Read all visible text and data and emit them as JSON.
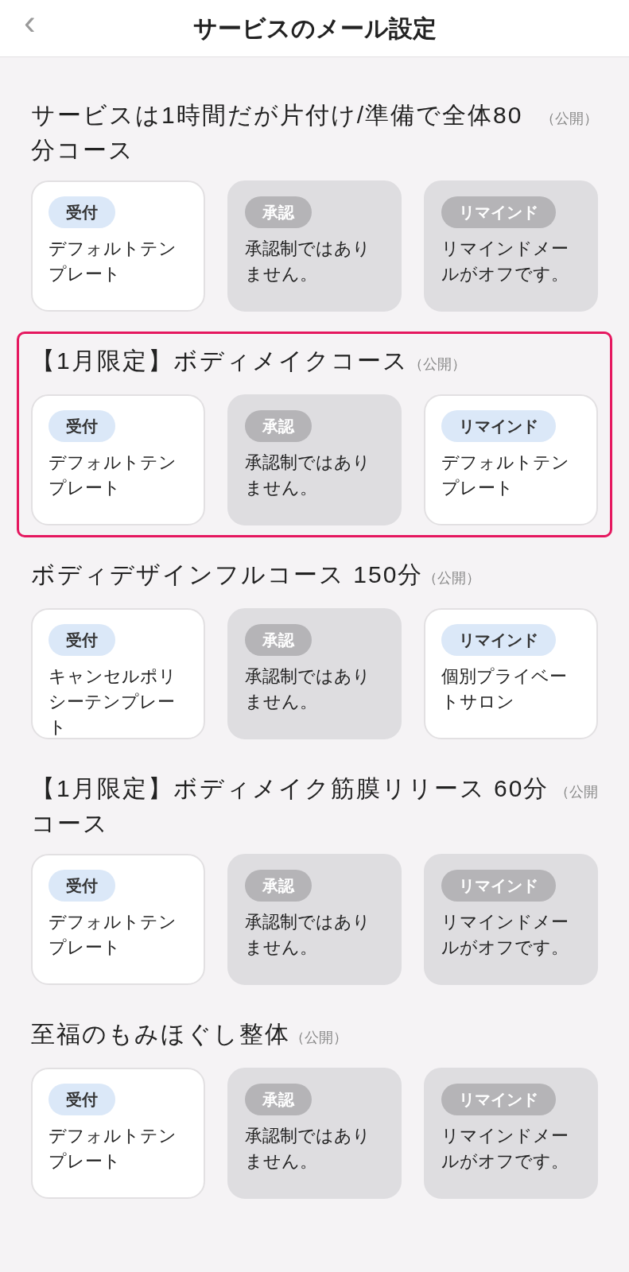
{
  "header": {
    "back": "‹",
    "title": "サービスのメール設定"
  },
  "services": [
    {
      "title": "サービスは1時間だが片付け/準備で全体80分コース",
      "status": "（公開）",
      "highlighted": false,
      "cards": [
        {
          "label": "受付",
          "text": "デフォルトテンプレート",
          "enabled": true
        },
        {
          "label": "承認",
          "text": "承認制ではありません。",
          "enabled": false
        },
        {
          "label": "リマインド",
          "text": "リマインドメールがオフです。",
          "enabled": false
        }
      ]
    },
    {
      "title": "【1月限定】ボディメイクコース",
      "status": "（公開）",
      "highlighted": true,
      "cards": [
        {
          "label": "受付",
          "text": "デフォルトテンプレート",
          "enabled": true
        },
        {
          "label": "承認",
          "text": "承認制ではありません。",
          "enabled": false
        },
        {
          "label": "リマインド",
          "text": "デフォルトテンプレート",
          "enabled": true
        }
      ]
    },
    {
      "title": "ボディデザインフルコース 150分",
      "status": "（公開）",
      "highlighted": false,
      "cards": [
        {
          "label": "受付",
          "text": "キャンセルポリシーテンプレート",
          "enabled": true
        },
        {
          "label": "承認",
          "text": "承認制ではありません。",
          "enabled": false
        },
        {
          "label": "リマインド",
          "text": "個別プライベートサロン",
          "enabled": true
        }
      ]
    },
    {
      "title": "【1月限定】ボディメイク筋膜リリース 60分コース",
      "status": "（公開",
      "highlighted": false,
      "cards": [
        {
          "label": "受付",
          "text": "デフォルトテンプレート",
          "enabled": true
        },
        {
          "label": "承認",
          "text": "承認制ではありません。",
          "enabled": false
        },
        {
          "label": "リマインド",
          "text": "リマインドメールがオフです。",
          "enabled": false
        }
      ]
    },
    {
      "title": "至福のもみほぐし整体",
      "status": "（公開）",
      "highlighted": false,
      "cards": [
        {
          "label": "受付",
          "text": "デフォルトテンプレート",
          "enabled": true
        },
        {
          "label": "承認",
          "text": "承認制ではありません。",
          "enabled": false
        },
        {
          "label": "リマインド",
          "text": "リマインドメールがオフです。",
          "enabled": false
        }
      ]
    }
  ]
}
